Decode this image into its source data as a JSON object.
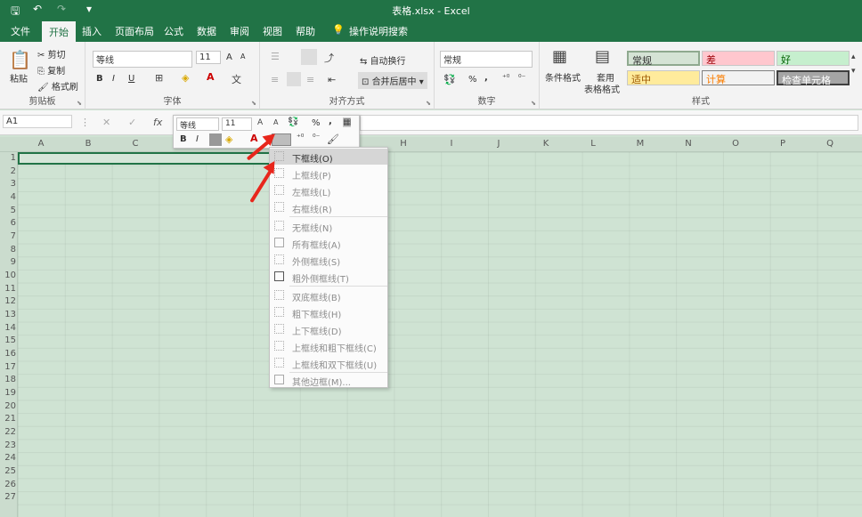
{
  "window": {
    "title": "表格.xlsx  -  Excel"
  },
  "tabs": [
    "文件",
    "开始",
    "插入",
    "页面布局",
    "公式",
    "数据",
    "审阅",
    "视图",
    "帮助",
    "操作说明搜索"
  ],
  "clipboard": {
    "paste": "粘贴",
    "cut": "剪切",
    "copy": "复制",
    "format_painter": "格式刷",
    "group": "剪贴板"
  },
  "font": {
    "name": "等线",
    "size": "11",
    "group": "字体",
    "bold": "B",
    "italic": "I",
    "underline": "U",
    "grow": "A",
    "shrink": "A"
  },
  "alignment": {
    "wrap": "自动换行",
    "merge": "合并后居中",
    "group": "对齐方式"
  },
  "number": {
    "format": "常规",
    "group": "数字",
    "percent": "%",
    "comma": ","
  },
  "styles": {
    "cond_format": "条件格式",
    "table_format_1": "套用",
    "table_format_2": "表格格式",
    "group": "样式",
    "normal": "常规",
    "bad": "差",
    "good": "好",
    "neutral": "适中",
    "calc": "计算",
    "check": "检查单元格"
  },
  "formula_bar": {
    "name_box": "A1",
    "fx": "fx"
  },
  "mini_toolbar": {
    "font": "等线",
    "size": "11",
    "percent": "%",
    "comma": ",",
    "bold": "B",
    "italic": "I"
  },
  "columns": [
    "A",
    "B",
    "C",
    "D",
    "E",
    "F",
    "G",
    "H",
    "I",
    "J",
    "K",
    "L",
    "M",
    "N",
    "O",
    "P",
    "Q"
  ],
  "rows": [
    "1",
    "2",
    "3",
    "4",
    "5",
    "6",
    "7",
    "8",
    "9",
    "10",
    "11",
    "12",
    "13",
    "14",
    "15",
    "16",
    "17",
    "18",
    "19",
    "20",
    "21",
    "22",
    "23",
    "24",
    "25",
    "26",
    "27"
  ],
  "border_menu": {
    "items": [
      "下框线(O)",
      "上框线(P)",
      "左框线(L)",
      "右框线(R)",
      "无框线(N)",
      "所有框线(A)",
      "外侧框线(S)",
      "粗外侧框线(T)",
      "双底框线(B)",
      "粗下框线(H)",
      "上下框线(D)",
      "上框线和粗下框线(C)",
      "上框线和双下框线(U)",
      "其他边框(M)..."
    ]
  },
  "colors": {
    "excel_green": "#217346",
    "annotation_red": "#e8261c",
    "bad_bg": "#ffc7ce",
    "good_bg": "#c6efce",
    "neutral_bg": "#ffeb9c"
  }
}
